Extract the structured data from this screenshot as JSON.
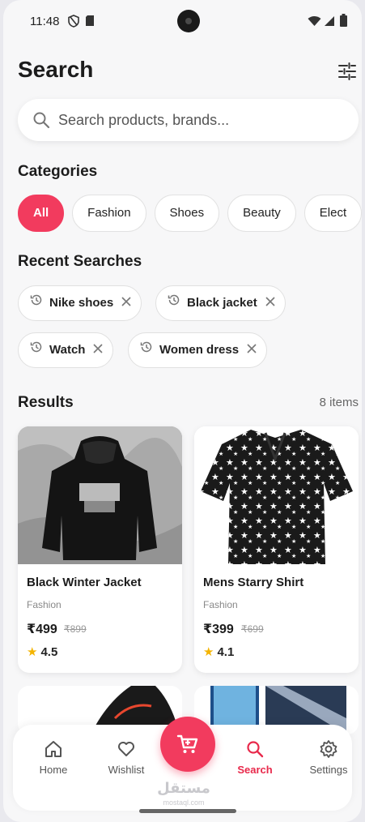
{
  "status": {
    "time": "11:48"
  },
  "header": {
    "title": "Search",
    "filter_icon": "sliders-icon"
  },
  "search": {
    "placeholder": "Search products, brands..."
  },
  "categories": {
    "title": "Categories",
    "items": [
      "All",
      "Fashion",
      "Shoes",
      "Beauty",
      "Elect"
    ]
  },
  "recent": {
    "title": "Recent Searches",
    "items": [
      "Nike shoes",
      "Black jacket",
      "Watch",
      "Women dress"
    ]
  },
  "results": {
    "title": "Results",
    "count": "8 items",
    "products": [
      {
        "name": "Black Winter Jacket",
        "category": "Fashion",
        "price": "₹499",
        "old_price": "₹899",
        "rating": "4.5"
      },
      {
        "name": "Mens Starry Shirt",
        "category": "Fashion",
        "price": "₹399",
        "old_price": "₹699",
        "rating": "4.1"
      }
    ]
  },
  "nav": {
    "items": [
      "Home",
      "Wishlist",
      "Search",
      "Settings"
    ],
    "active": "Search"
  },
  "watermark": {
    "text": "مستقل",
    "sub": "mostaql.com"
  },
  "colors": {
    "accent": "#f23b5e",
    "active_nav": "#e8294b",
    "star": "#f4b400"
  }
}
